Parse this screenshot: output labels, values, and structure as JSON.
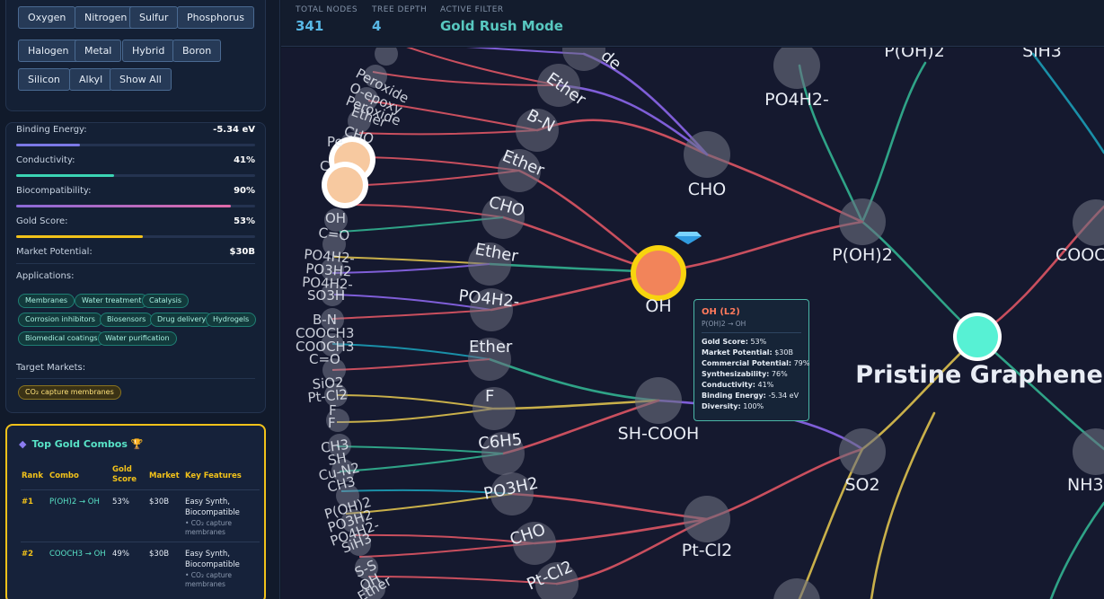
{
  "filters": [
    "Oxygen",
    "Nitrogen",
    "Sulfur",
    "Phosphorus",
    "Halogen",
    "Metal",
    "Hybrid",
    "Boron",
    "Silicon",
    "Alkyl",
    "Show All"
  ],
  "properties": [
    {
      "label": "Binding Energy:",
      "value": "-5.34 eV",
      "fill": 0.27,
      "color": "#7b78e6"
    },
    {
      "label": "Conductivity:",
      "value": "41%",
      "fill": 0.41,
      "color": "#3bd4b4"
    },
    {
      "label": "Biocompatibility:",
      "value": "90%",
      "fill": 0.9,
      "color": "#b26ad8"
    },
    {
      "label": "Gold Score:",
      "value": "53%",
      "fill": 0.53,
      "color": "#f2c21a"
    },
    {
      "label": "Market Potential:",
      "value": "$30B"
    }
  ],
  "applications_label": "Applications:",
  "applications": [
    "Membranes",
    "Water treatment",
    "Catalysis",
    "Corrosion inhibitors",
    "Biosensors",
    "Drug delivery",
    "Hydrogels",
    "Biomedical coatings",
    "Water purification"
  ],
  "markets_label": "Target Markets:",
  "markets": [
    "CO₂ capture membranes"
  ],
  "combos": {
    "title": "Top Gold Combos 🏆",
    "headers": [
      "Rank",
      "Combo",
      "Gold Score",
      "Market",
      "Key Features"
    ],
    "rows": [
      {
        "rank": "#1",
        "combo": "P(OH)2 → OH",
        "score": "53%",
        "market": "$30B",
        "features": "Easy Synth, Biocompatible",
        "sub": "• CO₂ capture membranes"
      },
      {
        "rank": "#2",
        "combo": "COOCH3 → OH",
        "score": "49%",
        "market": "$30B",
        "features": "Easy Synth, Biocompatible",
        "sub": "• CO₂ capture membranes"
      }
    ]
  },
  "header": {
    "total_nodes_label": "TOTAL NODES",
    "total_nodes": "341",
    "depth_label": "TREE DEPTH",
    "depth": "4",
    "filter_label": "ACTIVE FILTER",
    "filter": "Gold Rush Mode"
  },
  "graph": {
    "root": "Pristine Graphene",
    "mid_nodes": [
      "PO4H2-",
      "CHO",
      "P(OH)2",
      "SO2",
      "Pt-Cl2",
      "OH",
      "SH-COOH",
      "COOC",
      "NH3",
      "P(OH)2",
      "SiH3"
    ],
    "ring_labels": [
      "Ether",
      "B-N",
      "Ether",
      "CHO",
      "Ether",
      "PO4H2-",
      "Ether",
      "F",
      "C6H5",
      "PO3H2",
      "CHO",
      "Pt-Cl2",
      "de"
    ],
    "outer_labels": [
      "Peroxide",
      "O-epoxy",
      "Peroxide",
      "Ether",
      "CHO",
      "Pe",
      "C",
      "OH",
      "C=O",
      "PO4H2-",
      "PO3H2",
      "PO4H2-",
      "SO3H",
      "B-N",
      "COOCH3",
      "COOCH3",
      "C=O",
      "SiO2",
      "Pt-Cl2",
      "F",
      "F",
      "CH3",
      "SH",
      "Cu-N2",
      "CH3",
      "P(OH)2",
      "PO3H2",
      "PO4H2-",
      "SiH3",
      "S-S",
      "OH",
      "Ether"
    ],
    "gem_icon": "gem-icon"
  },
  "tooltip": {
    "title": "OH (L2)",
    "path": "P(OH)2 → OH",
    "rows": [
      {
        "k": "Gold Score:",
        "v": "53%"
      },
      {
        "k": "Market Potential:",
        "v": "$30B"
      },
      {
        "k": "Commercial Potential:",
        "v": "79%"
      },
      {
        "k": "Synthesizability:",
        "v": "76%"
      },
      {
        "k": "Conductivity:",
        "v": "41%"
      },
      {
        "k": "Binding Energy:",
        "v": "-5.34 eV"
      },
      {
        "k": "Diversity:",
        "v": "100%"
      }
    ]
  }
}
